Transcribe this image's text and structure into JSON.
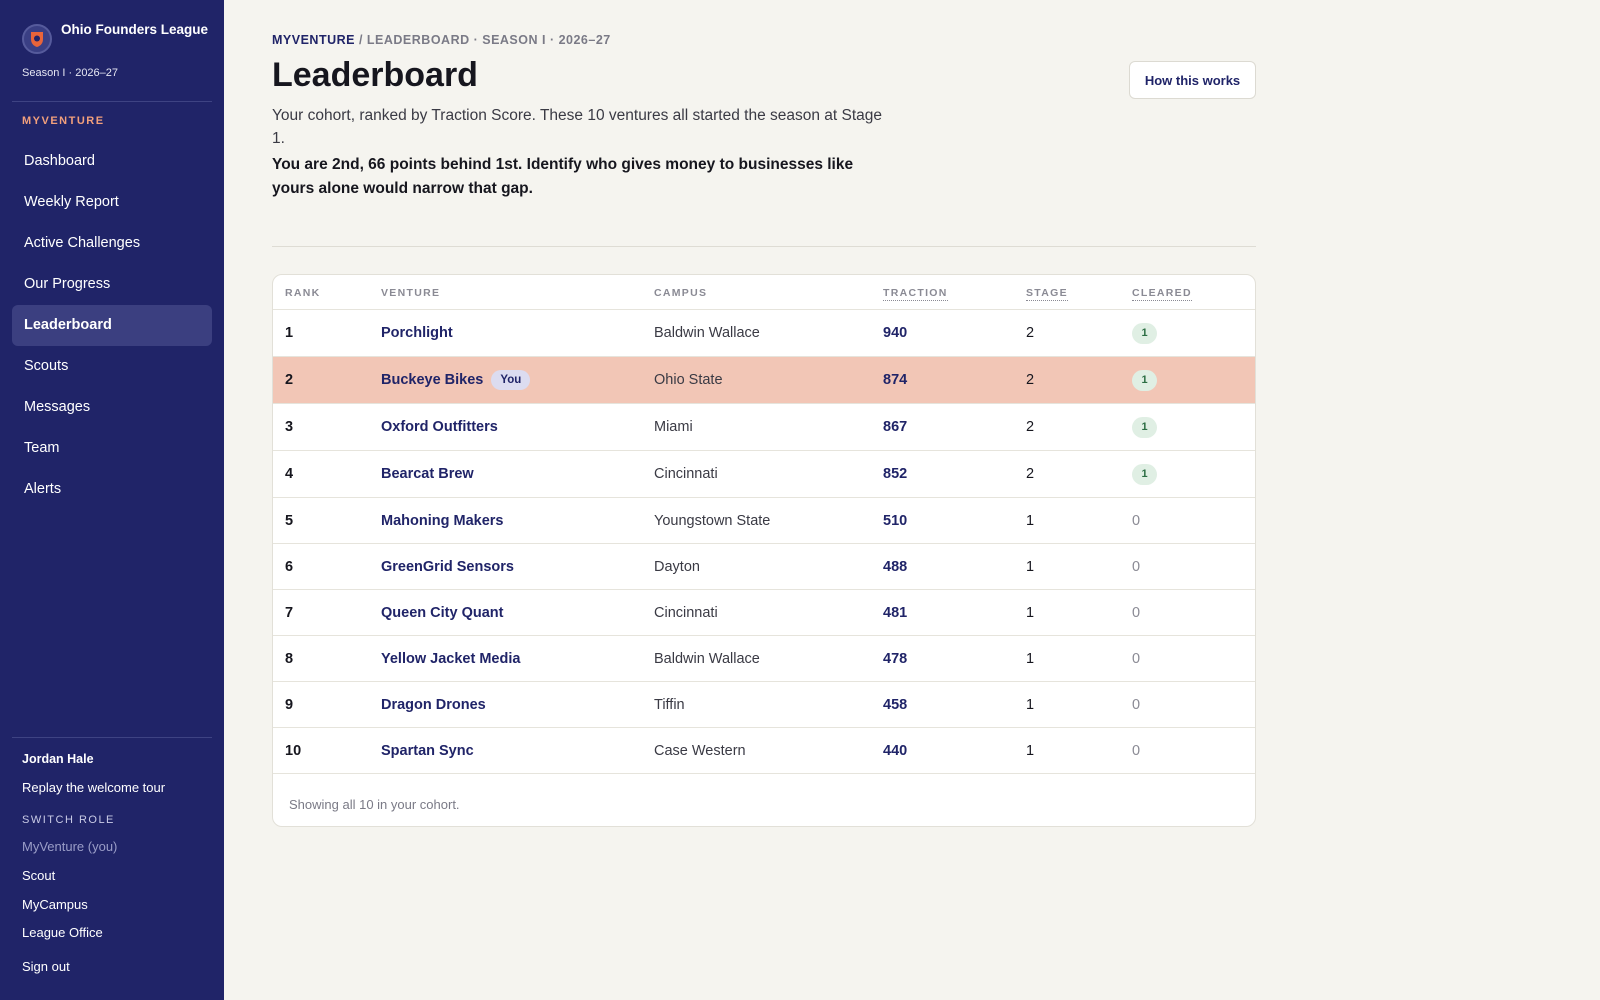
{
  "sidebar": {
    "brand_name": "Ohio Founders League",
    "season": "Season I · 2026–27",
    "section_label": "MYVENTURE",
    "nav": [
      {
        "label": "Dashboard"
      },
      {
        "label": "Weekly Report"
      },
      {
        "label": "Active Challenges"
      },
      {
        "label": "Our Progress"
      },
      {
        "label": "Leaderboard",
        "active": true
      },
      {
        "label": "Scouts"
      },
      {
        "label": "Messages"
      },
      {
        "label": "Team"
      },
      {
        "label": "Alerts"
      }
    ],
    "user_name": "Jordan Hale",
    "replay_tour": "Replay the welcome tour",
    "switch_role_label": "SWITCH ROLE",
    "roles": [
      "MyVenture (you)",
      "Scout",
      "MyCampus",
      "League Office"
    ],
    "sign_out": "Sign out"
  },
  "header": {
    "breadcrumb_home": "MYVENTURE",
    "breadcrumb_rest": " / LEADERBOARD · SEASON I · 2026–27",
    "title": "Leaderboard",
    "how_button": "How this works",
    "intro": "Your cohort, ranked by Traction Score. These 10 ventures all started the season at Stage 1.",
    "callout": "You are 2nd, 66 points behind 1st. Identify who gives money to businesses like yours alone would narrow that gap."
  },
  "table": {
    "columns": [
      "RANK",
      "VENTURE",
      "CAMPUS",
      "TRACTION",
      "STAGE",
      "CLEARED"
    ],
    "you_badge": "You",
    "rows": [
      {
        "rank": "1",
        "venture": "Porchlight",
        "campus": "Baldwin Wallace",
        "traction": "940",
        "stage": "2",
        "cleared": "1"
      },
      {
        "rank": "2",
        "venture": "Buckeye Bikes",
        "campus": "Ohio State",
        "traction": "874",
        "stage": "2",
        "cleared": "1",
        "you": true
      },
      {
        "rank": "3",
        "venture": "Oxford Outfitters",
        "campus": "Miami",
        "traction": "867",
        "stage": "2",
        "cleared": "1"
      },
      {
        "rank": "4",
        "venture": "Bearcat Brew",
        "campus": "Cincinnati",
        "traction": "852",
        "stage": "2",
        "cleared": "1"
      },
      {
        "rank": "5",
        "venture": "Mahoning Makers",
        "campus": "Youngstown State",
        "traction": "510",
        "stage": "1",
        "cleared": "0"
      },
      {
        "rank": "6",
        "venture": "GreenGrid Sensors",
        "campus": "Dayton",
        "traction": "488",
        "stage": "1",
        "cleared": "0"
      },
      {
        "rank": "7",
        "venture": "Queen City Quant",
        "campus": "Cincinnati",
        "traction": "481",
        "stage": "1",
        "cleared": "0"
      },
      {
        "rank": "8",
        "venture": "Yellow Jacket Media",
        "campus": "Baldwin Wallace",
        "traction": "478",
        "stage": "1",
        "cleared": "0"
      },
      {
        "rank": "9",
        "venture": "Dragon Drones",
        "campus": "Tiffin",
        "traction": "458",
        "stage": "1",
        "cleared": "0"
      },
      {
        "rank": "10",
        "venture": "Spartan Sync",
        "campus": "Case Western",
        "traction": "440",
        "stage": "1",
        "cleared": "0"
      }
    ],
    "footer": "Showing all 10 in your cohort."
  }
}
